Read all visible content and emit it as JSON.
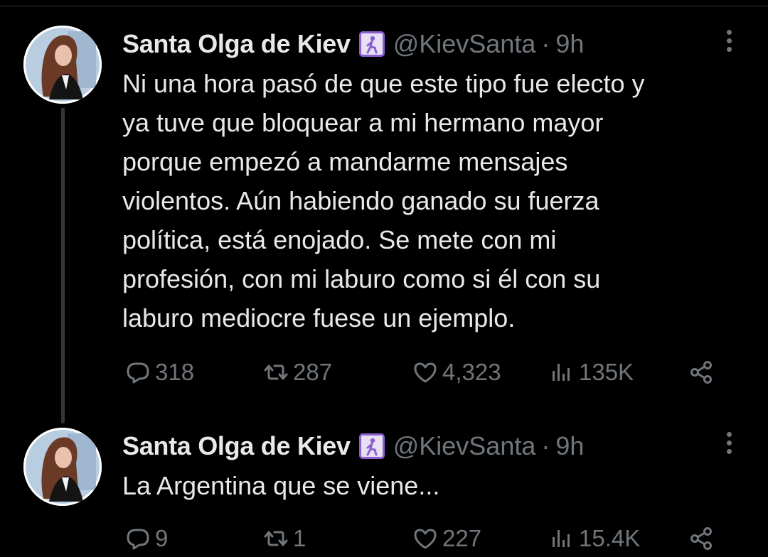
{
  "tweets": [
    {
      "name": "Santa Olga de Kiev",
      "badge_icon": "person-kneeling-emoji",
      "handle": "@KievSanta",
      "separator": "·",
      "time": "9h",
      "lines": [
        "Ni una hora pasó de que este tipo fue electo y",
        "ya tuve que bloquear a mi hermano mayor",
        "porque empezó a mandarme mensajes",
        "violentos. Aún habiendo ganado su fuerza",
        "política, está enojado. Se mete con mi",
        "profesión, con mi laburo como si él con su",
        "laburo mediocre fuese un ejemplo."
      ],
      "replies": "318",
      "retweets": "287",
      "likes": "4,323",
      "views": "135K"
    },
    {
      "name": "Santa Olga de Kiev",
      "badge_icon": "person-kneeling-emoji",
      "handle": "@KievSanta",
      "separator": "·",
      "time": "9h",
      "lines": [
        "La Argentina que se viene..."
      ],
      "replies": "9",
      "retweets": "1",
      "likes": "227",
      "views": "15.4K"
    }
  ],
  "colors": {
    "background": "#000000",
    "primary_text": "#e7e9ea",
    "secondary_text": "#71767b",
    "thread_line": "#333639"
  }
}
